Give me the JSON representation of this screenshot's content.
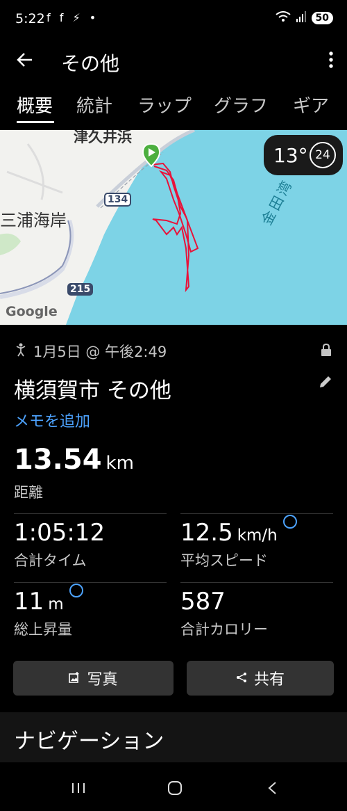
{
  "status": {
    "time": "5:22",
    "left_icons": "f f ⚡ •",
    "battery": "50"
  },
  "appbar": {
    "title": "その他"
  },
  "tabs": [
    "概要",
    "統計",
    "ラップ",
    "グラフ",
    "ギア"
  ],
  "map": {
    "labels": {
      "place1": "津久井浜",
      "place2": "三浦海岸",
      "bay": "金田湾",
      "route134": "134",
      "route215": "215",
      "google": "Google"
    }
  },
  "weather": {
    "temp": "13°",
    "wind": "24"
  },
  "activity": {
    "date_time": "1月5日 @ 午後2:49",
    "name": "横須賀市 その他",
    "add_note": "メモを追加"
  },
  "stats": {
    "distance": {
      "value": "13.54",
      "unit": "km",
      "label": "距離"
    },
    "total_time": {
      "value": "1:05:12",
      "label": "合計タイム"
    },
    "avg_speed": {
      "value": "12.5",
      "unit": "km/h",
      "label": "平均スピード"
    },
    "ascent": {
      "value": "11",
      "unit": "m",
      "label": "総上昇量"
    },
    "calories": {
      "value": "587",
      "label": "合計カロリー"
    }
  },
  "buttons": {
    "photo": "写真",
    "share": "共有"
  },
  "nav_section": {
    "title": "ナビゲーション"
  },
  "colors": {
    "accent": "#4da3ff",
    "route": "#e8133a",
    "water": "#7dd3e6",
    "start_marker": "#4caf3f"
  }
}
